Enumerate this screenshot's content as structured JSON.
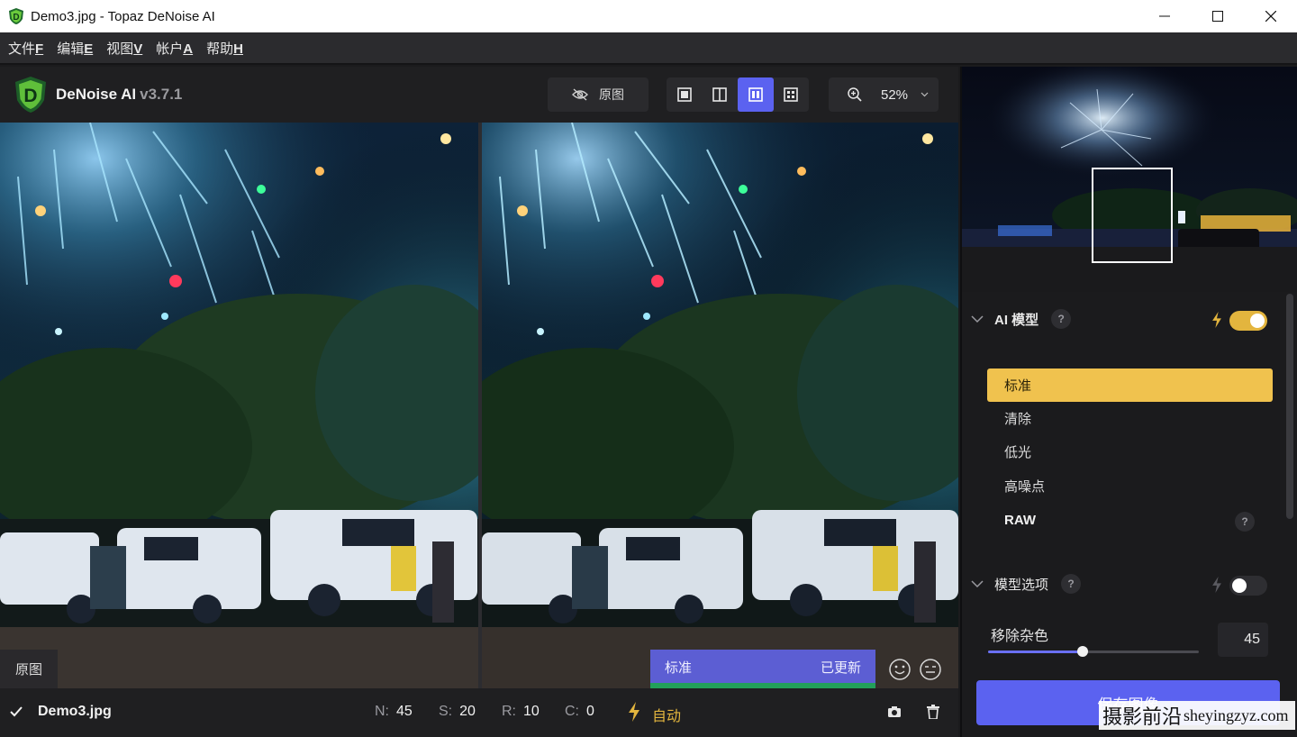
{
  "window": {
    "title": "Demo3.jpg - Topaz DeNoise AI"
  },
  "menu": [
    {
      "label": "文件",
      "key": "F"
    },
    {
      "label": "编辑",
      "key": "E"
    },
    {
      "label": "视图",
      "key": "V"
    },
    {
      "label": "帐户",
      "key": "A"
    },
    {
      "label": "帮助",
      "key": "H"
    }
  ],
  "toolbar": {
    "brand": "DeNoise AI",
    "version": "v3.7.1",
    "original_label": "原图",
    "zoom": "52%",
    "active_view": "side-by-side"
  },
  "viewer": {
    "left_tag": "原图",
    "model_tag": "标准",
    "status_tag": "已更新"
  },
  "statusbar": {
    "filename": "Demo3.jpg",
    "n_label": "N:",
    "n_value": "45",
    "s_label": "S:",
    "s_value": "20",
    "r_label": "R:",
    "r_value": "10",
    "c_label": "C:",
    "c_value": "0",
    "auto_label": "自动"
  },
  "panel": {
    "ai_model": {
      "title": "AI 模型",
      "help": "?",
      "toggle_on": true,
      "items": [
        "标准",
        "清除",
        "低光",
        "高噪点",
        "RAW"
      ],
      "selected": "标准"
    },
    "model_options": {
      "title": "模型选项",
      "help": "?",
      "toggle_on": false,
      "remove_noise_label": "移除杂色",
      "remove_noise_value": "45"
    },
    "save_label": "保存图像"
  },
  "watermark": {
    "cn": "摄影前沿",
    "url": "sheyingzyz.com"
  },
  "colors": {
    "accent": "#5b62f0",
    "selected_model": "#f0c24e",
    "toggle_on": "#e3b53e",
    "updated_bar": "#22a05a"
  }
}
